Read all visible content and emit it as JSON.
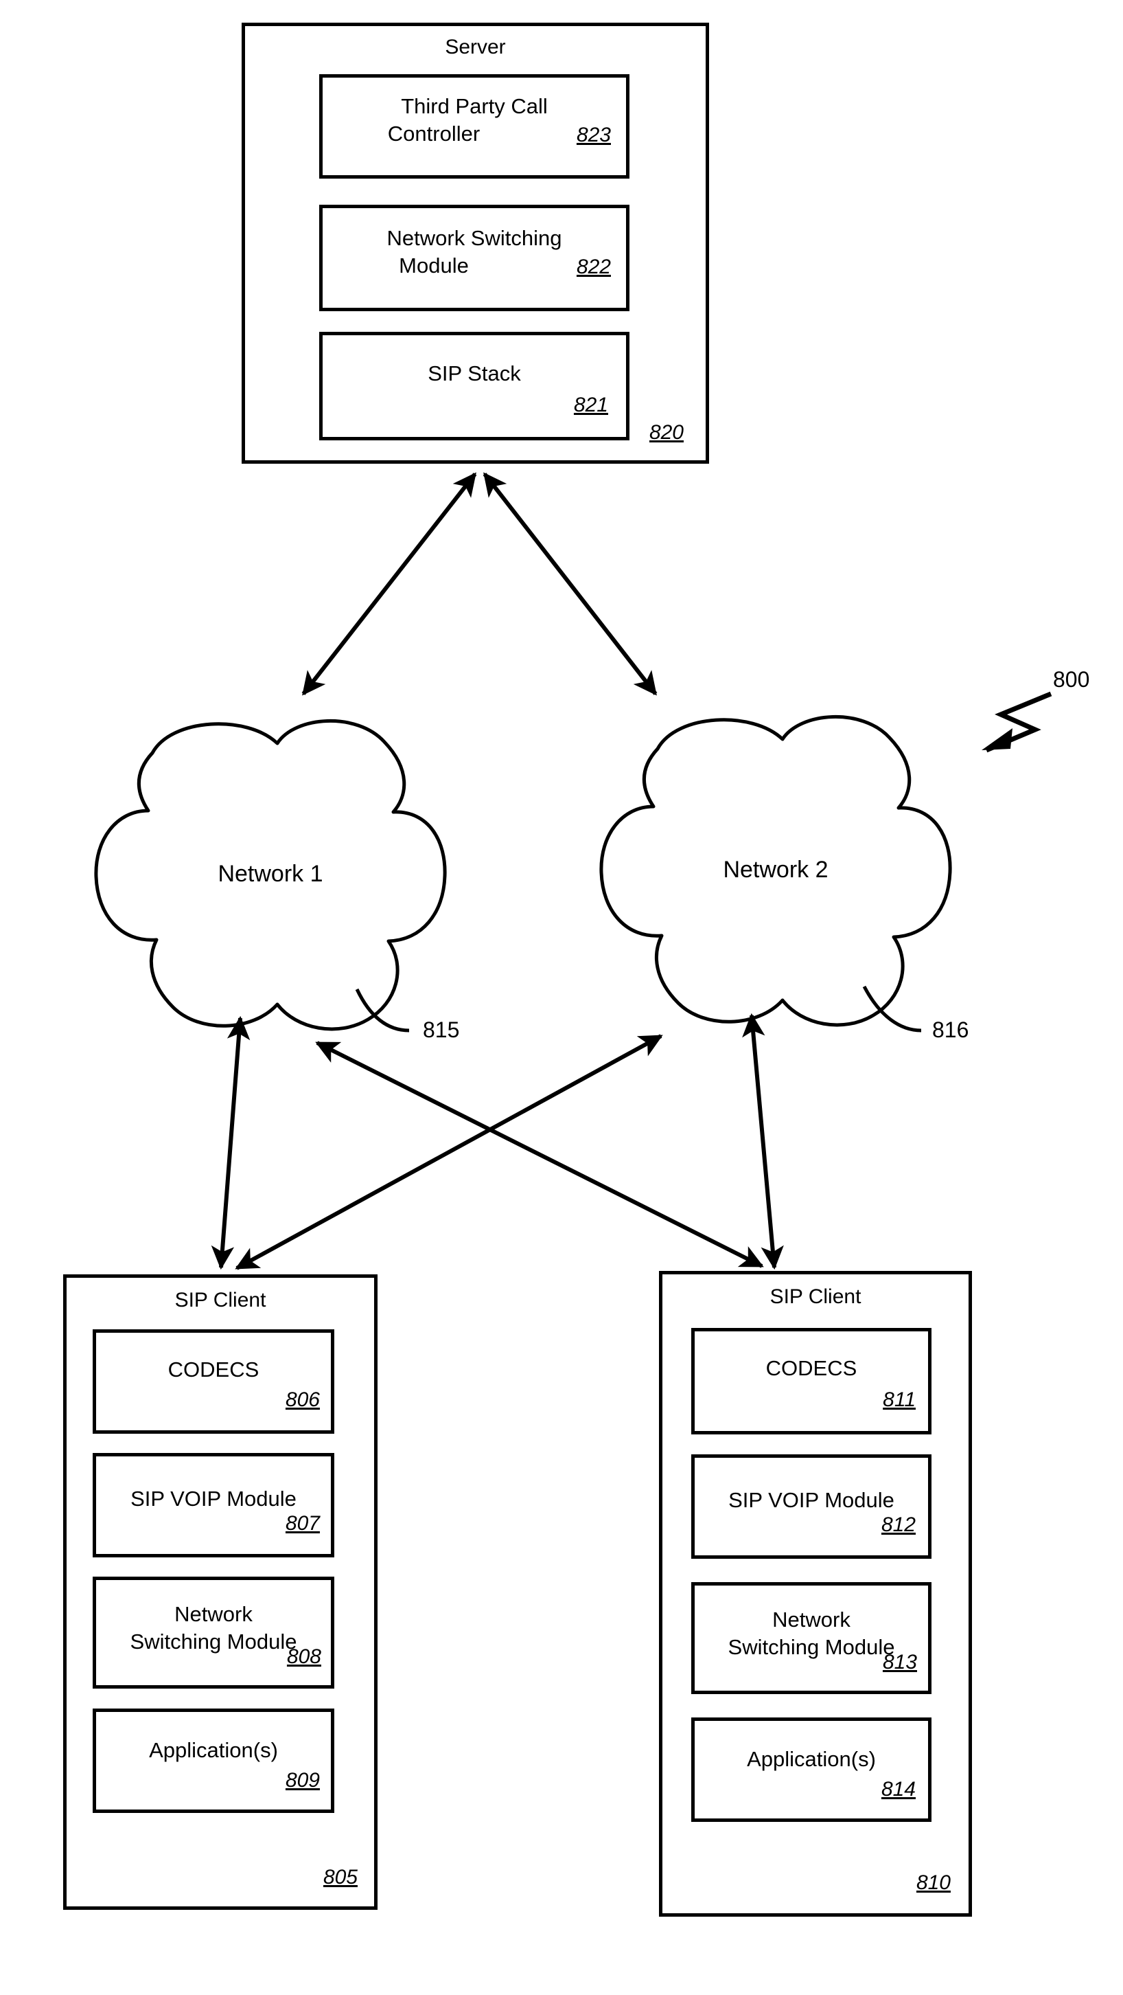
{
  "figure": {
    "ref_label": "800"
  },
  "server": {
    "title": "Server",
    "ref": "820",
    "modules": [
      {
        "name": "third-party-call-controller",
        "label_line1": "Third Party Call",
        "label_line2": "Controller",
        "ref": "823"
      },
      {
        "name": "network-switching-module",
        "label_line1": "Network Switching",
        "label_line2": "Module",
        "ref": "822"
      },
      {
        "name": "sip-stack",
        "label_line1": "SIP Stack",
        "label_line2": "",
        "ref": "821"
      }
    ]
  },
  "networks": [
    {
      "name": "network-1",
      "label": "Network 1",
      "ref": "815"
    },
    {
      "name": "network-2",
      "label": "Network 2",
      "ref": "816"
    }
  ],
  "clients": [
    {
      "name": "sip-client-left",
      "title": "SIP Client",
      "ref": "805",
      "modules": [
        {
          "name": "codecs",
          "label_line1": "CODECS",
          "label_line2": "",
          "ref": "806"
        },
        {
          "name": "sip-voip-module",
          "label_line1": "SIP VOIP Module",
          "label_line2": "",
          "ref": "807"
        },
        {
          "name": "network-switching-module",
          "label_line1": "Network",
          "label_line2": "Switching Module",
          "ref": "808"
        },
        {
          "name": "applications",
          "label_line1": "Application(s)",
          "label_line2": "",
          "ref": "809"
        }
      ]
    },
    {
      "name": "sip-client-right",
      "title": "SIP Client",
      "ref": "810",
      "modules": [
        {
          "name": "codecs",
          "label_line1": "CODECS",
          "label_line2": "",
          "ref": "811"
        },
        {
          "name": "sip-voip-module",
          "label_line1": "SIP VOIP Module",
          "label_line2": "",
          "ref": "812"
        },
        {
          "name": "network-switching-module",
          "label_line1": "Network",
          "label_line2": "Switching Module",
          "ref": "813"
        },
        {
          "name": "applications",
          "label_line1": "Application(s)",
          "label_line2": "",
          "ref": "814"
        }
      ]
    }
  ]
}
